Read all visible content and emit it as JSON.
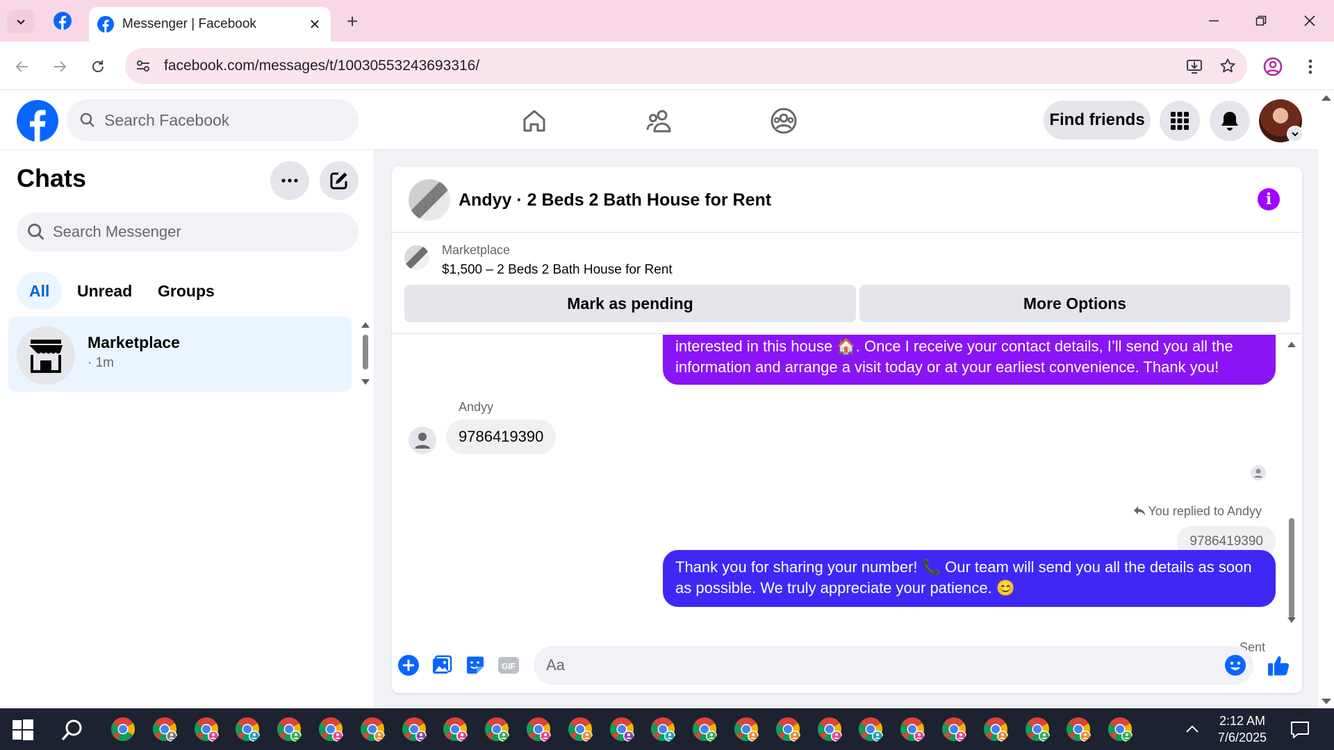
{
  "browser": {
    "tab_title": "Messenger | Facebook",
    "url": "facebook.com/messages/t/10030553243693316/"
  },
  "header": {
    "search_placeholder": "Search Facebook",
    "find_friends_label": "Find friends"
  },
  "sidebar": {
    "title": "Chats",
    "search_placeholder": "Search Messenger",
    "filters": [
      "All",
      "Unread",
      "Groups"
    ],
    "active_filter": "All",
    "chats": [
      {
        "name": "Marketplace",
        "time": "· 1m"
      }
    ]
  },
  "conversation": {
    "title": "Andyy · 2 Beds 2 Bath House for Rent",
    "marketplace_label": "Marketplace",
    "listing": "$1,500 – 2 Beds 2 Bath House for Rent",
    "mark_pending_label": "Mark as pending",
    "more_options_label": "More Options",
    "messages": {
      "outgoing_1_line1": "interested in this house 🏠. Once I receive your contact details, I’ll send you all the",
      "outgoing_1_line2": "information and arrange a visit today or at your earliest convenience. Thank you!",
      "incoming_sender": "Andyy",
      "incoming_text": "9786419390",
      "replied_label": "You replied to Andyy",
      "quoted_text": "9786419390",
      "outgoing_2_line1": "Thank you for sharing your number! 📞 Our team will send you all the details as soon",
      "outgoing_2_line2": "as possible. We truly appreciate your patience. 😊",
      "status": "Sent"
    },
    "composer_placeholder": "Aa"
  },
  "taskbar": {
    "time": "2:12 AM",
    "date": "7/6/2025"
  },
  "colors": {
    "facebook_blue": "#0866ff",
    "messenger_purple": "#7b1cff",
    "messenger_blue": "#3f28f6",
    "tab_strip": "#f8d8e6"
  }
}
